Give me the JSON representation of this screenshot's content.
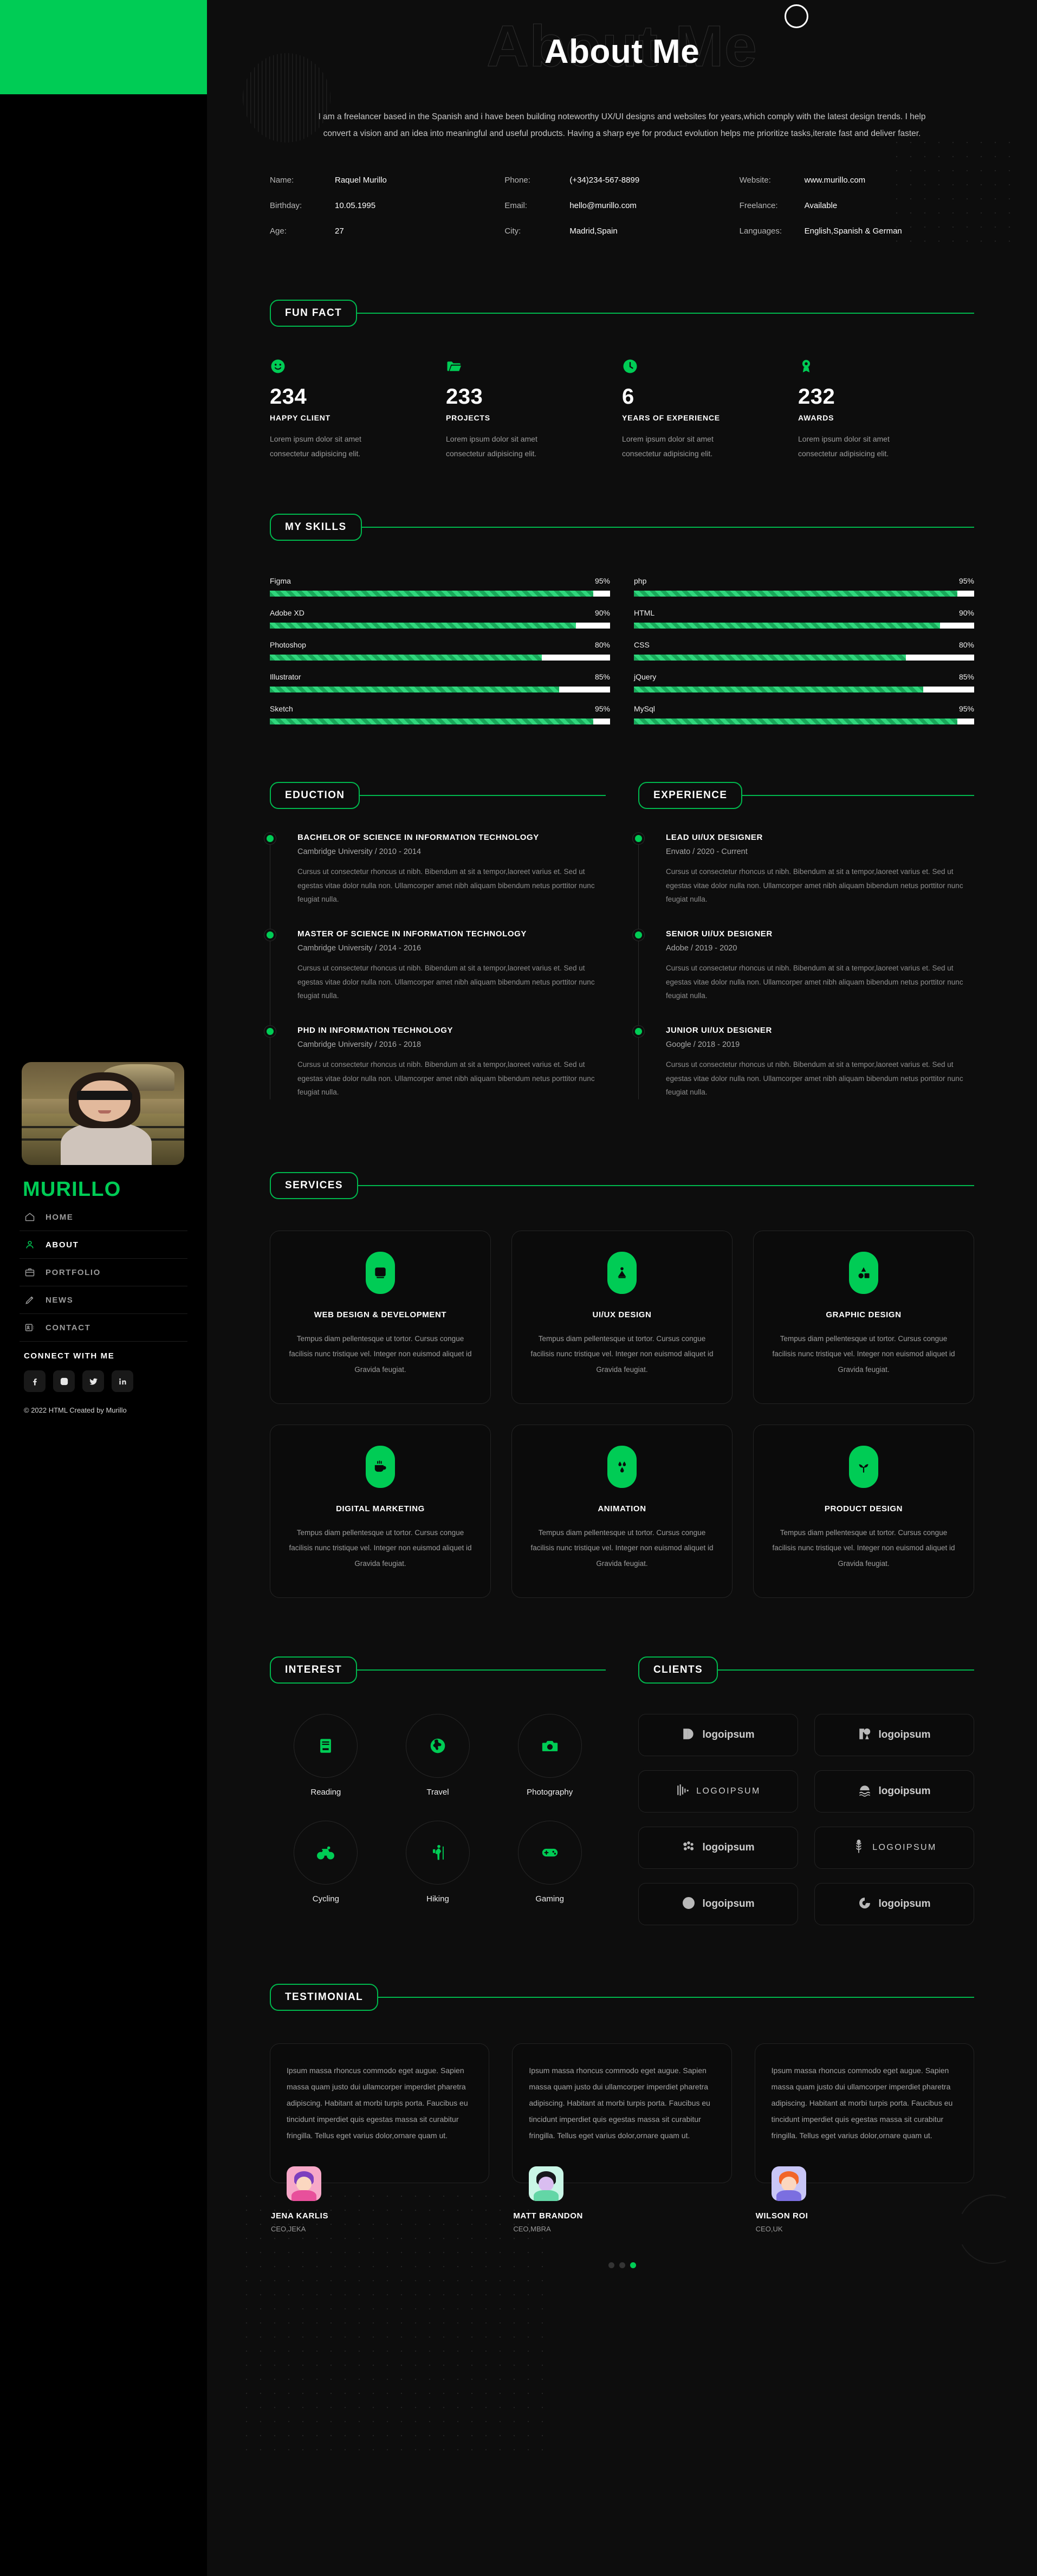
{
  "sidebar": {
    "brand": "MURILLO",
    "nav": [
      {
        "label": "HOME",
        "icon": "home-icon",
        "active": false
      },
      {
        "label": "ABOUT",
        "icon": "user-icon",
        "active": true
      },
      {
        "label": "PORTFOLIO",
        "icon": "briefcase-icon",
        "active": false
      },
      {
        "label": "NEWS",
        "icon": "pencil-icon",
        "active": false
      },
      {
        "label": "CONTACT",
        "icon": "contact-card-icon",
        "active": false
      }
    ],
    "connect_title": "CONNECT WITH ME",
    "socials": [
      {
        "name": "facebook-icon"
      },
      {
        "name": "instagram-icon"
      },
      {
        "name": "twitter-icon"
      },
      {
        "name": "linkedin-icon"
      }
    ],
    "copyright": "© 2022 HTML Created by Murillo"
  },
  "hero": {
    "ghost_title": "About Me",
    "title": "About Me",
    "intro": "I am a freelancer based in the Spanish and i have been building noteworthy UX/UI designs and websites for years,which comply with the latest design trends. I help convert a vision and an idea into meaningful and useful products. Having a sharp eye for product evolution helps me prioritize tasks,iterate fast and deliver faster."
  },
  "info": [
    {
      "key": "Name:",
      "value": "Raquel Murillo"
    },
    {
      "key": "Phone:",
      "value": "(+34)234-567-8899"
    },
    {
      "key": "Website:",
      "value": "www.murillo.com"
    },
    {
      "key": "Birthday:",
      "value": "10.05.1995"
    },
    {
      "key": "Email:",
      "value": "hello@murillo.com"
    },
    {
      "key": "Freelance:",
      "value": "Available"
    },
    {
      "key": "Age:",
      "value": "27"
    },
    {
      "key": "City:",
      "value": "Madrid,Spain"
    },
    {
      "key": "Languages:",
      "value": "English,Spanish & German"
    }
  ],
  "fun_fact": {
    "heading": "FUN FACT",
    "items": [
      {
        "icon": "smile-icon",
        "number": "234",
        "label": "HAPPY CLIENT",
        "text": "Lorem ipsum dolor sit amet consectetur adipisicing elit."
      },
      {
        "icon": "folder-icon",
        "number": "233",
        "label": "PROJECTS",
        "text": "Lorem ipsum dolor sit amet consectetur adipisicing elit."
      },
      {
        "icon": "clock-icon",
        "number": "6",
        "label": "YEARS OF EXPERIENCE",
        "text": "Lorem ipsum dolor sit amet consectetur adipisicing elit."
      },
      {
        "icon": "award-icon",
        "number": "232",
        "label": "AWARDS",
        "text": "Lorem ipsum dolor sit amet consectetur adipisicing elit."
      }
    ]
  },
  "skills": {
    "heading": "MY SKILLS",
    "items": [
      {
        "name": "Figma",
        "percent": "95%",
        "value": 95
      },
      {
        "name": "php",
        "percent": "95%",
        "value": 95
      },
      {
        "name": "Adobe XD",
        "percent": "90%",
        "value": 90
      },
      {
        "name": "HTML",
        "percent": "90%",
        "value": 90
      },
      {
        "name": "Photoshop",
        "percent": "80%",
        "value": 80
      },
      {
        "name": "CSS",
        "percent": "80%",
        "value": 80
      },
      {
        "name": "Illustrator",
        "percent": "85%",
        "value": 85
      },
      {
        "name": "jQuery",
        "percent": "85%",
        "value": 85
      },
      {
        "name": "Sketch",
        "percent": "95%",
        "value": 95
      },
      {
        "name": "MySql",
        "percent": "95%",
        "value": 95
      }
    ]
  },
  "education": {
    "heading": "EDUCTION",
    "items": [
      {
        "title": "BACHELOR OF SCIENCE IN INFORMATION TECHNOLOGY",
        "sub": "Cambridge University / 2010 - 2014",
        "desc": "Cursus ut consectetur rhoncus ut nibh. Bibendum at sit a tempor,laoreet varius et. Sed ut egestas vitae dolor nulla non. Ullamcorper amet nibh aliquam bibendum netus porttitor nunc feugiat nulla."
      },
      {
        "title": "MASTER OF SCIENCE IN INFORMATION TECHNOLOGY",
        "sub": "Cambridge University / 2014 - 2016",
        "desc": "Cursus ut consectetur rhoncus ut nibh. Bibendum at sit a tempor,laoreet varius et. Sed ut egestas vitae dolor nulla non. Ullamcorper amet nibh aliquam bibendum netus porttitor nunc feugiat nulla."
      },
      {
        "title": "PHD IN INFORMATION TECHNOLOGY",
        "sub": "Cambridge University / 2016 - 2018",
        "desc": "Cursus ut consectetur rhoncus ut nibh. Bibendum at sit a tempor,laoreet varius et. Sed ut egestas vitae dolor nulla non. Ullamcorper amet nibh aliquam bibendum netus porttitor nunc feugiat nulla."
      }
    ]
  },
  "experience": {
    "heading": "EXPERIENCE",
    "items": [
      {
        "title": "LEAD UI/UX DESIGNER",
        "sub": "Envato / 2020 - Current",
        "desc": "Cursus ut consectetur rhoncus ut nibh. Bibendum at sit a tempor,laoreet varius et. Sed ut egestas vitae dolor nulla non. Ullamcorper amet nibh aliquam bibendum netus porttitor nunc feugiat nulla."
      },
      {
        "title": "SENIOR UI/UX DESIGNER",
        "sub": "Adobe / 2019 - 2020",
        "desc": "Cursus ut consectetur rhoncus ut nibh. Bibendum at sit a tempor,laoreet varius et. Sed ut egestas vitae dolor nulla non. Ullamcorper amet nibh aliquam bibendum netus porttitor nunc feugiat nulla."
      },
      {
        "title": "JUNIOR UI/UX DESIGNER",
        "sub": "Google / 2018 - 2019",
        "desc": "Cursus ut consectetur rhoncus ut nibh. Bibendum at sit a tempor,laoreet varius et. Sed ut egestas vitae dolor nulla non. Ullamcorper amet nibh aliquam bibendum netus porttitor nunc feugiat nulla."
      }
    ]
  },
  "services": {
    "heading": "SERVICES",
    "items": [
      {
        "icon": "code-window-icon",
        "title": "WEB DESIGN & DEVELOPMENT",
        "text": "Tempus diam pellentesque ut tortor. Cursus congue facilisis nunc tristique vel. Integer non euismod aliquet id Gravida feugiat."
      },
      {
        "icon": "layers-person-icon",
        "title": "UI/UX DESIGN",
        "text": "Tempus diam pellentesque ut tortor. Cursus congue facilisis nunc tristique vel. Integer non euismod aliquet id Gravida feugiat."
      },
      {
        "icon": "shapes-icon",
        "title": "GRAPHIC DESIGN",
        "text": "Tempus diam pellentesque ut tortor. Cursus congue facilisis nunc tristique vel. Integer non euismod aliquet id Gravida feugiat."
      },
      {
        "icon": "coffee-cup-icon",
        "title": "DIGITAL MARKETING",
        "text": "Tempus diam pellentesque ut tortor. Cursus congue facilisis nunc tristique vel. Integer non euismod aliquet id Gravida feugiat."
      },
      {
        "icon": "droplets-icon",
        "title": "ANIMATION",
        "text": "Tempus diam pellentesque ut tortor. Cursus congue facilisis nunc tristique vel. Integer non euismod aliquet id Gravida feugiat."
      },
      {
        "icon": "seedling-icon",
        "title": "PRODUCT DESIGN",
        "text": "Tempus diam pellentesque ut tortor. Cursus congue facilisis nunc tristique vel. Integer non euismod aliquet id Gravida feugiat."
      }
    ]
  },
  "interest": {
    "heading": "INTEREST",
    "items": [
      {
        "icon": "book-icon",
        "label": "Reading"
      },
      {
        "icon": "globe-icon",
        "label": "Travel"
      },
      {
        "icon": "camera-icon",
        "label": "Photography"
      },
      {
        "icon": "bicycle-icon",
        "label": "Cycling"
      },
      {
        "icon": "hiker-icon",
        "label": "Hiking"
      },
      {
        "icon": "gamepad-icon",
        "label": "Gaming"
      }
    ]
  },
  "clients": {
    "heading": "CLIENTS",
    "items": [
      {
        "mark": "split-circle-mark",
        "name": "logoipsum",
        "style": "bold",
        "dot": true
      },
      {
        "mark": "pin-square-mark",
        "name": "logoipsum",
        "style": "bold",
        "dot": false
      },
      {
        "mark": "bars-mark",
        "name": "LOGOIPSUM",
        "style": "thin",
        "dot": false
      },
      {
        "mark": "sun-waves-mark",
        "name": "logoipsum",
        "style": "bold",
        "dot": false
      },
      {
        "mark": "dots-cluster-mark",
        "name": "logoipsum",
        "style": "bold",
        "dot": true
      },
      {
        "mark": "wheat-mark",
        "name": "LOGOIPSUM",
        "style": "thin",
        "dot": false
      },
      {
        "mark": "swirl-circle-mark",
        "name": "logoipsum",
        "style": "bold",
        "dot": false
      },
      {
        "mark": "pac-circle-mark",
        "name": "logoipsum",
        "style": "bold",
        "dot": false
      }
    ]
  },
  "testimonial": {
    "heading": "TESTIMONIAL",
    "items": [
      {
        "text": "Ipsum massa rhoncus commodo eget augue. Sapien massa quam justo dui ullamcorper imperdiet pharetra adipiscing. Habitant at morbi turpis porta. Faucibus eu tincidunt imperdiet quis egestas massa sit curabitur fringilla. Tellus eget varius dolor,ornare quam ut.",
        "name": "JENA KARLIS",
        "role": "CEO,JEKA",
        "bg": "#f7a8c8",
        "hair": "#7c3fbe",
        "skin": "#fbd7c0",
        "body": "#e8509b"
      },
      {
        "text": "Ipsum massa rhoncus commodo eget augue. Sapien massa quam justo dui ullamcorper imperdiet pharetra adipiscing. Habitant at morbi turpis porta. Faucibus eu tincidunt imperdiet quis egestas massa sit curabitur fringilla. Tellus eget varius dolor,ornare quam ut.",
        "name": "MATT BRANDON",
        "role": "CEO,MBRA",
        "bg": "#c9f6e6",
        "hair": "#17181c",
        "skin": "#d9bdf0",
        "body": "#63d6a6"
      },
      {
        "text": "Ipsum massa rhoncus commodo eget augue. Sapien massa quam justo dui ullamcorper imperdiet pharetra adipiscing. Habitant at morbi turpis porta. Faucibus eu tincidunt imperdiet quis egestas massa sit curabitur fringilla. Tellus eget varius dolor,ornare quam ut.",
        "name": "WILSON ROI",
        "role": "CEO,UK",
        "bg": "#c9c6f7",
        "hair": "#f2662a",
        "skin": "#fbd7c0",
        "body": "#7b6fe0"
      }
    ],
    "dots": [
      false,
      false,
      true
    ]
  },
  "colors": {
    "accent": "#00cc55",
    "accent_line": "#00b84d",
    "bg": "#0d0d0d",
    "sidebar_bg": "#000000"
  }
}
